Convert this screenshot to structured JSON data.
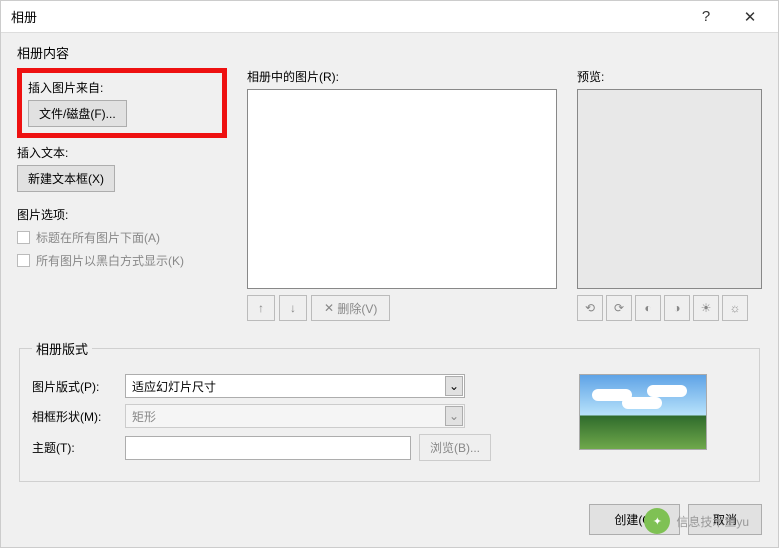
{
  "title": "相册",
  "help": "?",
  "close": "✕",
  "content_label": "相册内容",
  "insert_from": "插入图片来自:",
  "file_disk_btn": "文件/磁盘(F)...",
  "insert_text": "插入文本:",
  "new_textbox_btn": "新建文本框(X)",
  "pic_options": "图片选项:",
  "chk_caption": "标题在所有图片下面(A)",
  "chk_bw": "所有图片以黑白方式显示(K)",
  "pics_in_album": "相册中的图片(R):",
  "preview_label": "预览:",
  "delete_btn": "删除(V)",
  "layout_legend": "相册版式",
  "pic_layout_lbl": "图片版式(P):",
  "pic_layout_val": "适应幻灯片尺寸",
  "frame_shape_lbl": "相框形状(M):",
  "frame_shape_val": "矩形",
  "theme_lbl": "主题(T):",
  "browse_btn": "浏览(B)...",
  "create_btn": "创建(C)",
  "cancel_btn": "取消",
  "watermark_text": "信息技术鱼yu"
}
